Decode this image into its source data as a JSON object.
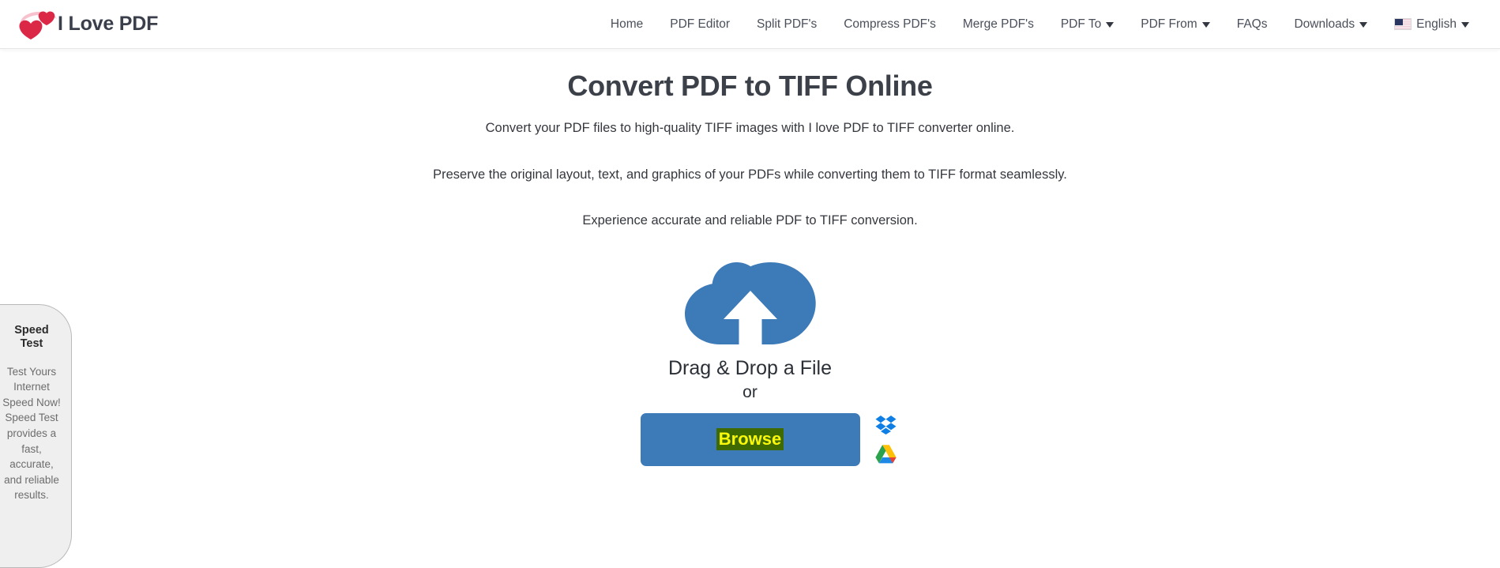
{
  "header": {
    "brand": {
      "title": "I Love PDF",
      "logo_icon": "two-hearts-logo"
    },
    "nav": [
      {
        "label": "Home",
        "has_caret": false,
        "icon": null
      },
      {
        "label": "PDF Editor",
        "has_caret": false,
        "icon": null
      },
      {
        "label": "Split PDF's",
        "has_caret": false,
        "icon": null
      },
      {
        "label": "Compress PDF's",
        "has_caret": false,
        "icon": null
      },
      {
        "label": "Merge PDF's",
        "has_caret": false,
        "icon": null
      },
      {
        "label": "PDF To",
        "has_caret": true,
        "icon": "chevron-down-icon"
      },
      {
        "label": "PDF From",
        "has_caret": true,
        "icon": "chevron-down-icon"
      },
      {
        "label": "FAQs",
        "has_caret": false,
        "icon": null
      },
      {
        "label": "Downloads",
        "has_caret": true,
        "icon": "chevron-down-icon"
      },
      {
        "label": "English",
        "has_caret": true,
        "icon": "us-flag-icon"
      }
    ]
  },
  "main": {
    "title": "Convert PDF to TIFF Online",
    "lead1": "Convert your PDF files to high-quality TIFF images with I love PDF to TIFF converter online.",
    "lead2": "Preserve the original layout, text, and graphics of your PDFs while converting them to TIFF format seamlessly.",
    "lead3": "Experience accurate and reliable PDF to TIFF conversion.",
    "dropzone": {
      "cloud_icon": "cloud-upload-icon",
      "drag_label": "Drag & Drop a File",
      "or_label": "or",
      "browse_label": "Browse",
      "browse_bg_color": "#3d7ab8",
      "browse_text_color": "#fbf90a",
      "browse_highlight_color": "#3f6a00",
      "services": [
        {
          "name": "dropbox-icon",
          "label": "Dropbox"
        },
        {
          "name": "google-drive-icon",
          "label": "Google Drive"
        }
      ]
    }
  },
  "speedtest": {
    "title": "Speed Test",
    "body": "Test Yours Internet Speed Now! Speed Test provides a fast, accurate, and reliable results."
  }
}
